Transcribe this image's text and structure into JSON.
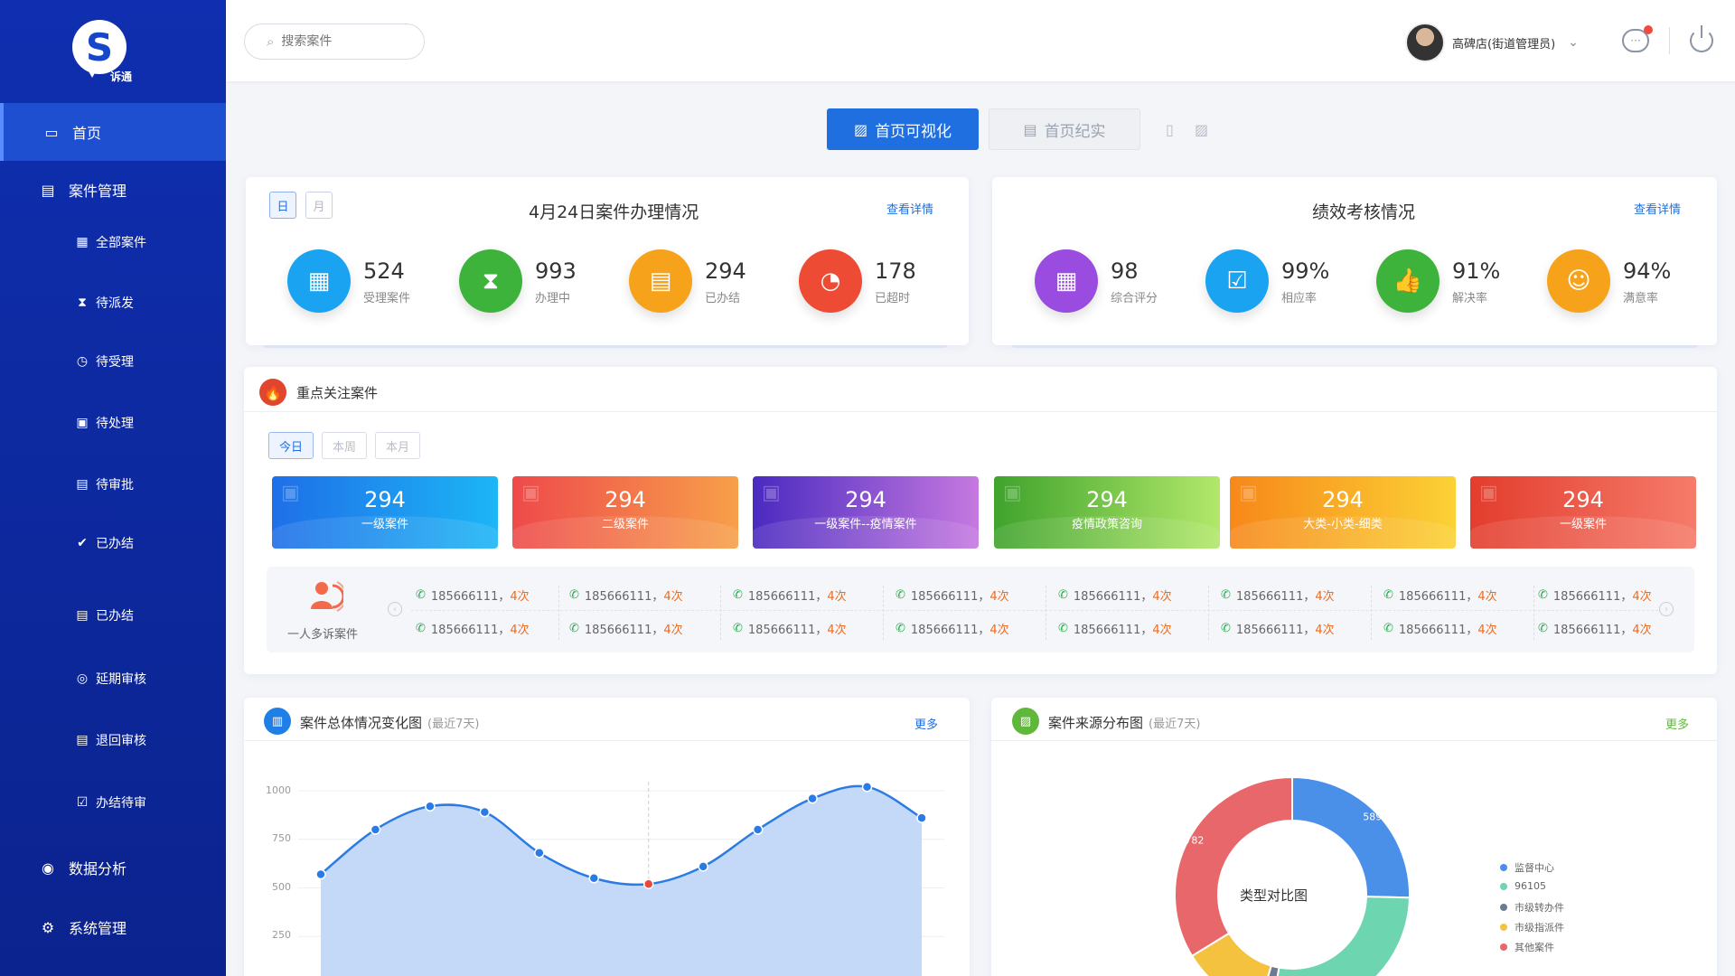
{
  "brand": {
    "name": "诉通",
    "logo_letter": "S"
  },
  "sidebar": {
    "items": [
      {
        "label": "首页",
        "icon": "monitor-icon"
      },
      {
        "label": "案件管理",
        "icon": "document-icon"
      },
      {
        "label": "全部案件",
        "icon": "grid-icon"
      },
      {
        "label": "待派发",
        "icon": "hourglass-icon"
      },
      {
        "label": "待受理",
        "icon": "clock-icon"
      },
      {
        "label": "待处理",
        "icon": "calendar-icon"
      },
      {
        "label": "待审批",
        "icon": "approve-icon"
      },
      {
        "label": "已办结",
        "icon": "check-circle-icon"
      },
      {
        "label": "已办结",
        "icon": "file-icon"
      },
      {
        "label": "延期审核",
        "icon": "delay-icon"
      },
      {
        "label": "退回审核",
        "icon": "return-icon"
      },
      {
        "label": "办结待审",
        "icon": "clipboard-check-icon"
      },
      {
        "label": "数据分析",
        "icon": "chart-icon"
      },
      {
        "label": "系统管理",
        "icon": "gear-icon"
      }
    ]
  },
  "header": {
    "search_placeholder": "搜索案件",
    "user_name": "高碑店(街道管理员)"
  },
  "view_tabs": {
    "visual": "首页可视化",
    "record": "首页纪实"
  },
  "case_card": {
    "seg_day": "日",
    "seg_month": "月",
    "title": "4月24日案件办理情况",
    "link": "查看详情",
    "stats": [
      {
        "value": "524",
        "label": "受理案件",
        "color": "#1aa3f0",
        "icon": "grid-icon"
      },
      {
        "value": "993",
        "label": "办理中",
        "color": "#3eb33c",
        "icon": "hourglass-icon"
      },
      {
        "value": "294",
        "label": "已办结",
        "color": "#f7a21b",
        "icon": "document-clock-icon"
      },
      {
        "value": "178",
        "label": "已超时",
        "color": "#ee4b35",
        "icon": "timer-icon"
      }
    ]
  },
  "perf_card": {
    "title": "绩效考核情况",
    "link": "查看详情",
    "stats": [
      {
        "value": "98",
        "label": "综合评分",
        "color": "#9a4be0",
        "icon": "grid-icon"
      },
      {
        "value": "99%",
        "label": "相应率",
        "color": "#1aa3f0",
        "icon": "clipboard-check-icon"
      },
      {
        "value": "91%",
        "label": "解决率",
        "color": "#3eb33c",
        "icon": "thumbs-up-icon"
      },
      {
        "value": "94%",
        "label": "满意率",
        "color": "#f7a21b",
        "icon": "smile-icon"
      }
    ]
  },
  "focus": {
    "title": "重点关注案件",
    "periods": [
      "今日",
      "本周",
      "本月"
    ],
    "tiles": [
      {
        "value": "294",
        "label": "一级案件",
        "from": "#1f6fe8",
        "to": "#1cb6f5"
      },
      {
        "value": "294",
        "label": "二级案件",
        "from": "#ee4a4a",
        "to": "#f7a04a"
      },
      {
        "value": "294",
        "label": "一级案件--疫情案件",
        "from": "#4a2ac0",
        "to": "#c679e0"
      },
      {
        "value": "294",
        "label": "疫情政策咨询",
        "from": "#3fa32c",
        "to": "#b2e86a"
      },
      {
        "value": "294",
        "label": "大类-小类-细类",
        "from": "#f7881a",
        "to": "#fbd235"
      },
      {
        "value": "294",
        "label": "一级案件",
        "from": "#e33d2d",
        "to": "#f57b6a"
      }
    ],
    "multi_label": "一人多诉案件",
    "calls_row1": [
      {
        "phone": "185666111，",
        "count": "4次"
      },
      {
        "phone": "185666111，",
        "count": "4次"
      },
      {
        "phone": "185666111，",
        "count": "4次"
      },
      {
        "phone": "185666111，",
        "count": "4次"
      },
      {
        "phone": "185666111，",
        "count": "4次"
      },
      {
        "phone": "185666111，",
        "count": "4次"
      },
      {
        "phone": "185666111，",
        "count": "4次"
      },
      {
        "phone": "185666111，",
        "count": "4次"
      }
    ],
    "calls_row2": [
      {
        "phone": "185666111，",
        "count": "4次"
      },
      {
        "phone": "185666111，",
        "count": "4次"
      },
      {
        "phone": "185666111，",
        "count": "4次"
      },
      {
        "phone": "185666111，",
        "count": "4次"
      },
      {
        "phone": "185666111，",
        "count": "4次"
      },
      {
        "phone": "185666111，",
        "count": "4次"
      },
      {
        "phone": "185666111，",
        "count": "4次"
      },
      {
        "phone": "185666111，",
        "count": "4次"
      }
    ]
  },
  "trend": {
    "title": "案件总体情况变化图",
    "sub": "(最近7天)",
    "more": "更多"
  },
  "source": {
    "title": "案件来源分布图",
    "sub": "(最近7天)",
    "more": "更多",
    "center": "类型对比图"
  },
  "chart_data": [
    {
      "type": "area",
      "title": "",
      "ylim": [
        0,
        1000
      ],
      "y_ticks": [
        "1000",
        "750",
        "500",
        "250"
      ],
      "values": [
        570,
        800,
        920,
        890,
        680,
        550,
        520,
        610,
        800,
        960,
        1020,
        860
      ],
      "highlight_index": 6,
      "grid": true,
      "color": "#2a7be4"
    },
    {
      "type": "pie",
      "title": "",
      "labels": [
        "监督中心",
        "96105",
        "市级转办件",
        "市级指派件",
        "其他案件"
      ],
      "values": [
        589,
        636,
        40,
        271,
        782
      ],
      "value_labels": [
        "589",
        "636",
        "",
        "271",
        "782"
      ],
      "colors": [
        "#4a8fe8",
        "#6dd6b0",
        "#6b7b93",
        "#f5c240",
        "#e8676b"
      ],
      "legend": "right"
    }
  ]
}
